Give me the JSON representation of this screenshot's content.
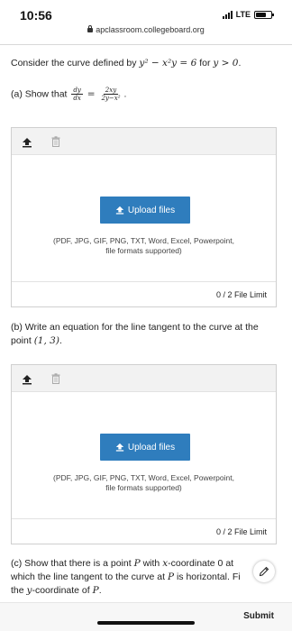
{
  "status_bar": {
    "time": "10:56",
    "network": "LTE"
  },
  "browser": {
    "url": "apclassroom.collegeboard.org"
  },
  "question": {
    "intro_prefix": "Consider the curve defined by",
    "intro_equation": "y² − x²y = 6",
    "intro_mid": "for",
    "intro_condition": "y > 0",
    "intro_end": ".",
    "part_a": {
      "label": "(a) Show that",
      "frac_left_num": "dy",
      "frac_left_den": "dx",
      "equals": "=",
      "frac_right_num": "2xy",
      "frac_right_den": "2y−x²",
      "end": "."
    },
    "part_b": {
      "text": "(b) Write an equation for the line tangent to the curve at the point",
      "point": "(1, 3)",
      "end": "."
    },
    "part_c": {
      "line1_prefix": "(c) Show that there is a point",
      "line1_P": "P",
      "line1_mid": "with",
      "line1_x": "x",
      "line1_suffix": "-coordinate 0 at",
      "line2_prefix": "which the line tangent to the curve at",
      "line2_P": "P",
      "line2_suffix": "is horizontal. Fi",
      "line3_prefix": "the",
      "line3_y": "y",
      "line3_mid": "-coordinate of",
      "line3_P": "P",
      "line3_end": "."
    }
  },
  "upload": {
    "button_label": "Upload files",
    "formats_line1": "(PDF, JPG, GIF, PNG, TXT, Word, Excel, Powerpoint,",
    "formats_line2": "file formats supported)",
    "file_limit": "0 / 2 File Limit"
  },
  "footer": {
    "submit_label": "Submit"
  },
  "colors": {
    "upload_button": "#2f7dbd",
    "toolbar_bg": "#f2f2f2"
  }
}
